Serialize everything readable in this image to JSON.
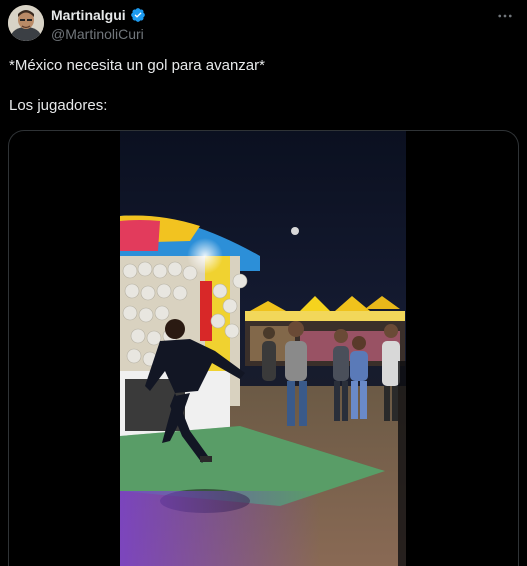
{
  "author": {
    "display_name": "Martinalgui",
    "handle": "@MartinoliCuri",
    "verified": true,
    "verified_color": "#1d9bf0"
  },
  "tweet": {
    "line1": "*México necesita un gol para avanzar*",
    "line2": "Los jugadores:"
  },
  "menu": {
    "icon": "more-horizontal-icon"
  },
  "colors": {
    "background": "#000000",
    "text": "#e7e9ea",
    "muted": "#71767b",
    "border": "#2f3336"
  }
}
